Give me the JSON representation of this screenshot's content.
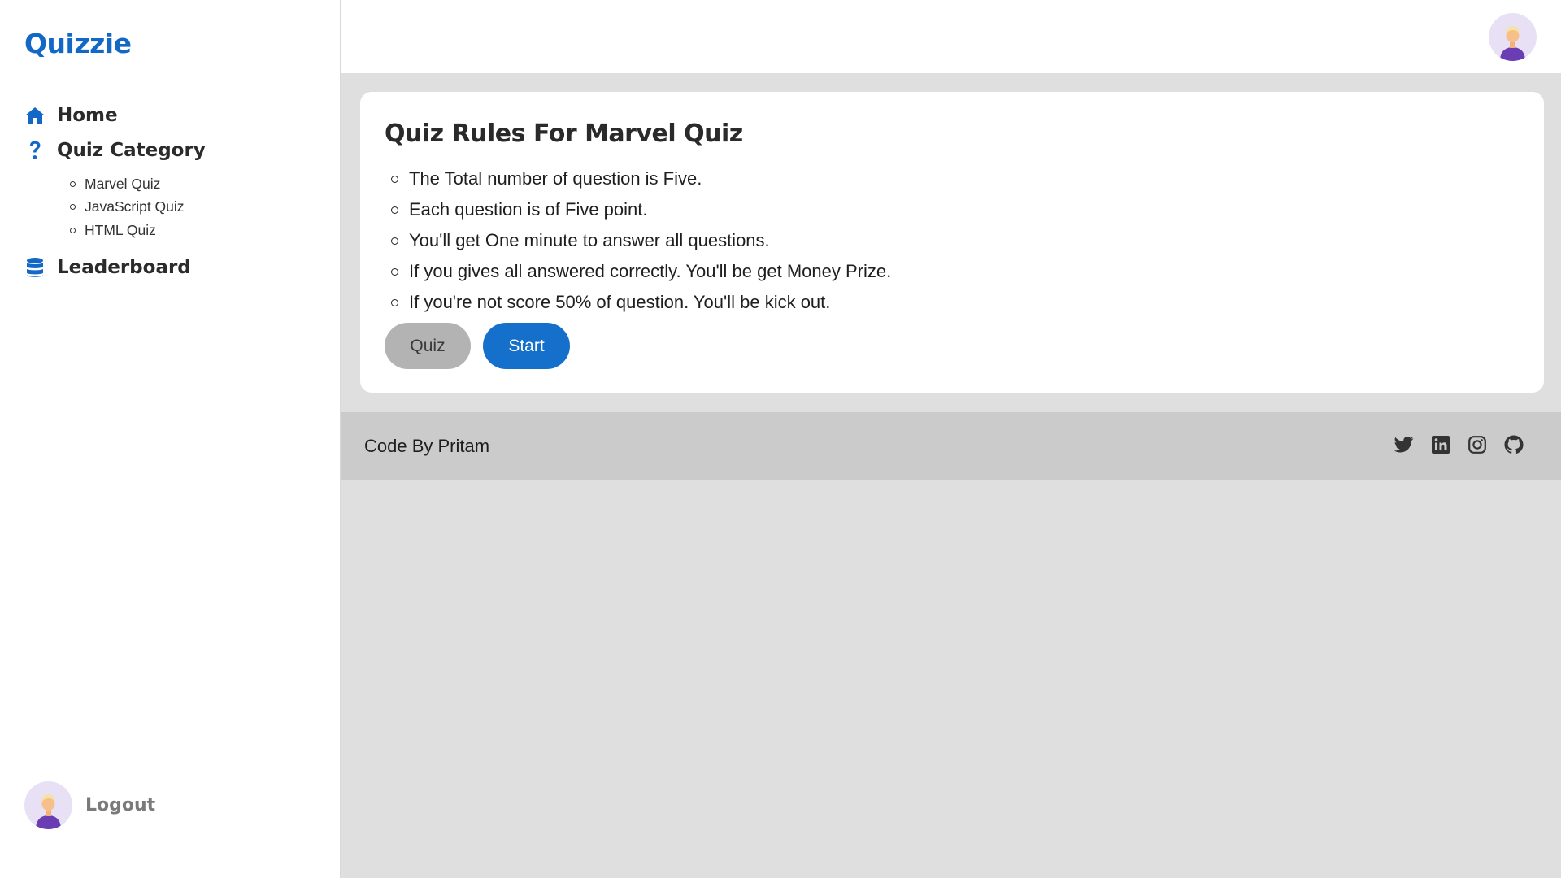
{
  "app": {
    "brand": "Quizzie"
  },
  "colors": {
    "accent": "#1368c7",
    "button_primary": "#1570cc",
    "button_secondary": "#b3b3b3",
    "footer_bg": "#cbcbcb"
  },
  "sidebar": {
    "items": [
      {
        "label": "Home",
        "icon": "home-icon"
      },
      {
        "label": "Quiz Category",
        "icon": "question-icon"
      },
      {
        "label": "Leaderboard",
        "icon": "database-icon"
      }
    ],
    "categories": [
      "Marvel Quiz",
      "JavaScript Quiz",
      "HTML Quiz"
    ],
    "logout_label": "Logout"
  },
  "header": {
    "avatar": "user-avatar"
  },
  "card": {
    "title": "Quiz Rules For Marvel Quiz",
    "rules": [
      "The Total number of question is Five.",
      "Each question is of Five point.",
      "You'll get One minute to answer all questions.",
      "If you gives all answered correctly. You'll be get Money Prize.",
      "If you're not score 50% of question. You'll be kick out."
    ],
    "quiz_button": "Quiz",
    "start_button": "Start"
  },
  "footer": {
    "text": "Code By Pritam",
    "social_icons": [
      "twitter-icon",
      "linkedin-icon",
      "instagram-icon",
      "github-icon"
    ]
  }
}
